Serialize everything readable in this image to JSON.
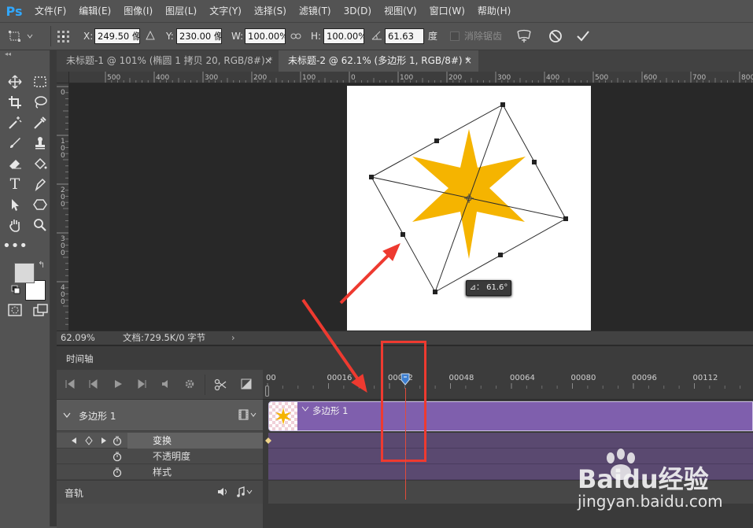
{
  "app": {
    "logo": "Ps"
  },
  "menu": [
    "文件(F)",
    "编辑(E)",
    "图像(I)",
    "图层(L)",
    "文字(Y)",
    "选择(S)",
    "滤镜(T)",
    "3D(D)",
    "视图(V)",
    "窗口(W)",
    "帮助(H)"
  ],
  "options": {
    "x_label": "X:",
    "x_value": "249.50 像素",
    "y_label": "Y:",
    "y_value": "230.00 像素",
    "w_label": "W:",
    "w_value": "100.00%",
    "h_label": "H:",
    "h_value": "100.00%",
    "angle_value": "61.63",
    "angle_unit": "度",
    "antialias_label": "消除锯齿"
  },
  "tabs": [
    {
      "label": "未标题-1 @ 101% (椭圆 1 拷贝 20, RGB/8#) *",
      "active": false
    },
    {
      "label": "未标题-2 @ 62.1% (多边形 1, RGB/8#) *",
      "active": true
    }
  ],
  "ruler_top": [
    "500",
    "400",
    "300",
    "200",
    "100",
    "0",
    "100",
    "200",
    "300",
    "400",
    "500",
    "600",
    "700",
    "800"
  ],
  "ruler_left": [
    "0",
    "1\n0\n0",
    "2\n0\n0",
    "3\n0\n0",
    "4\n0\n0"
  ],
  "canvas": {
    "angle_tooltip": "⊿： 61.6°",
    "star_color": "#f5b400"
  },
  "status": {
    "zoom": "62.09%",
    "doc_info": "文档:729.5K/0 字节"
  },
  "timeline": {
    "panel_title": "时间轴",
    "ruler_labels": [
      "00",
      "00016",
      "00032",
      "00048",
      "00064",
      "00080",
      "00096",
      "00112"
    ],
    "layer_name": "多边形 1",
    "clip_label": "多边形 1",
    "props": [
      "变换",
      "不透明度",
      "样式"
    ],
    "audio_label": "音轨"
  },
  "annotation_color": "#ee3a30",
  "watermark": {
    "brand": "Baidu经验",
    "url": "jingyan.baidu.com"
  }
}
